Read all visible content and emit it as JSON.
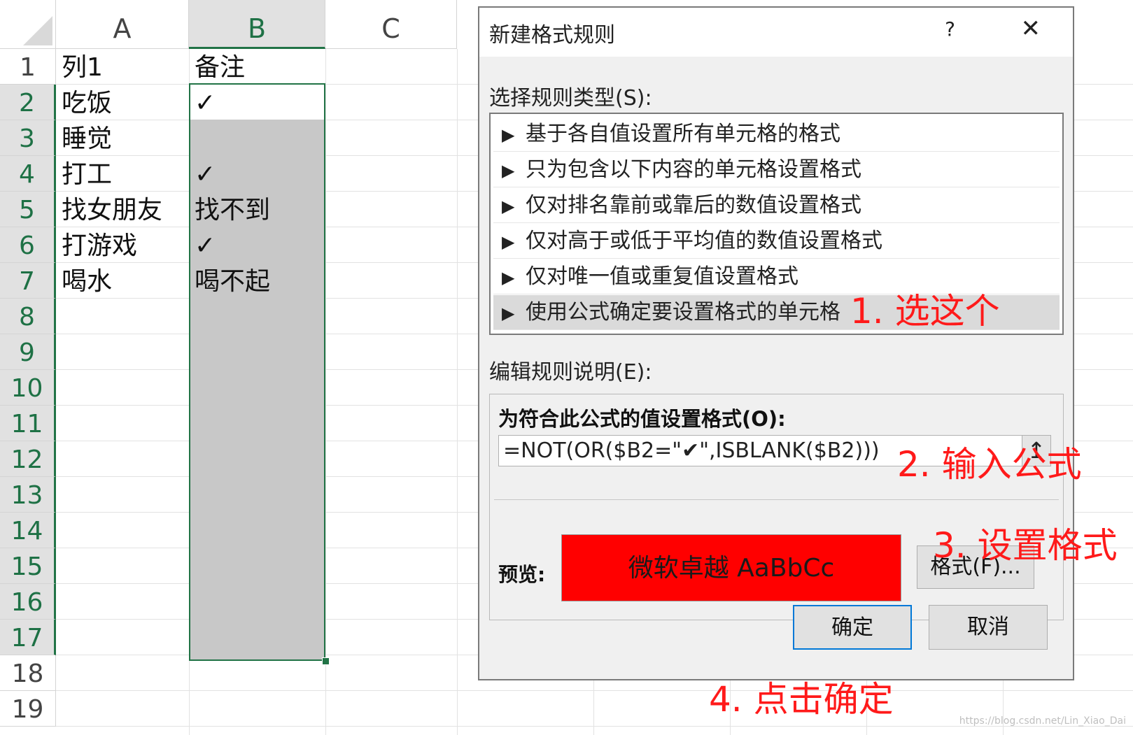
{
  "sheet": {
    "columns": [
      "A",
      "B",
      "C"
    ],
    "rows": [
      "1",
      "2",
      "3",
      "4",
      "5",
      "6",
      "7",
      "8",
      "9",
      "10",
      "11",
      "12",
      "13",
      "14",
      "15",
      "16",
      "17",
      "18",
      "19"
    ],
    "cells": {
      "a1": "列1",
      "b1": "备注",
      "a2": "吃饭",
      "b2": "✓",
      "a3": "睡觉",
      "b3": "",
      "a4": "打工",
      "b4": "✓",
      "a5": "找女朋友",
      "b5": "找不到",
      "a6": "打游戏",
      "b6": "✓",
      "a7": "喝水",
      "b7": "喝不起"
    },
    "selected_column": "B",
    "selected_rows": "2-17",
    "range_fill_color": "#c8c8c8",
    "accent": "#217346"
  },
  "dialog": {
    "title": "新建格式规则",
    "help": "?",
    "close": "✕",
    "rule_type_label": "选择规则类型(S):",
    "rule_types": [
      "基于各自值设置所有单元格的格式",
      "只为包含以下内容的单元格设置格式",
      "仅对排名靠前或靠后的数值设置格式",
      "仅对高于或低于平均值的数值设置格式",
      "仅对唯一值或重复值设置格式",
      "使用公式确定要设置格式的单元格"
    ],
    "rule_arrow": "▶",
    "selected_rule_index": 5,
    "edit_label": "编辑规则说明(E):",
    "formula_heading": "为符合此公式的值设置格式(O):",
    "formula_value": "=NOT(OR($B2=\"✔\",ISBLANK($B2)))",
    "collapse_icon": "↥",
    "preview_label": "预览:",
    "preview_text": "微软卓越  AaBbCc",
    "preview_fill": "#ff0000",
    "format_button": "格式(F)...",
    "ok_button": "确定",
    "cancel_button": "取消"
  },
  "annotations": {
    "step1": "1. 选这个",
    "step2": "2. 输入公式",
    "step3": "3. 设置格式",
    "step4": "4. 点击确定",
    "color": "#ff1a1a"
  },
  "watermark": "https://blog.csdn.net/Lin_Xiao_Dai"
}
